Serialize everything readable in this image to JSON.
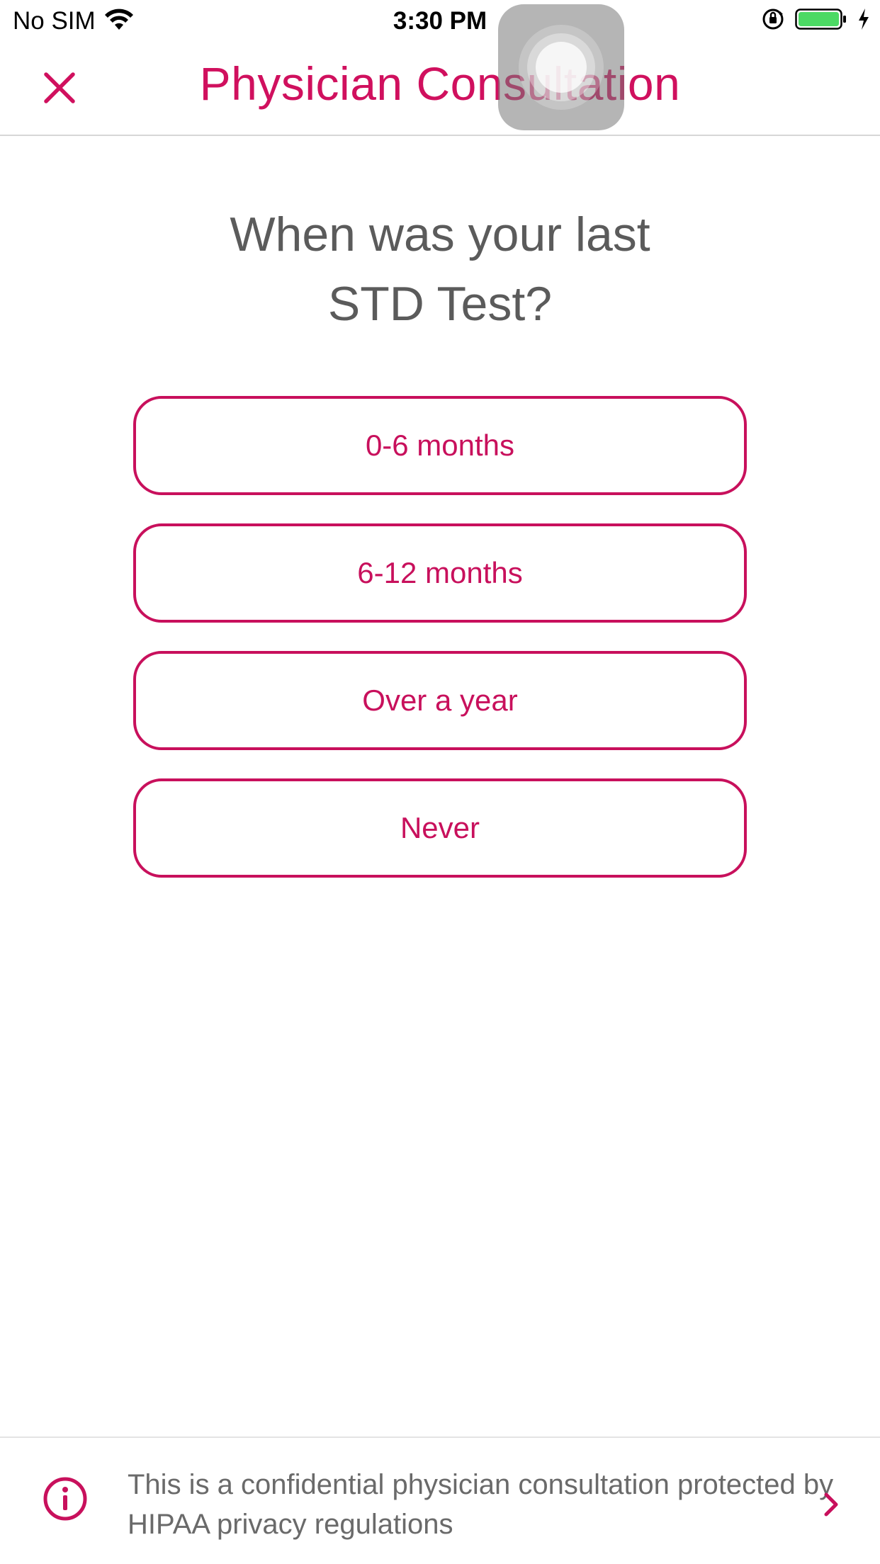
{
  "status_bar": {
    "carrier": "No SIM",
    "time": "3:30 PM",
    "battery_color": "#4cd964"
  },
  "nav": {
    "title": "Physician Consultation",
    "close_icon": "close-icon"
  },
  "question": {
    "line1": "When was your last",
    "line2": "STD Test?"
  },
  "options": [
    {
      "label": "0-6 months"
    },
    {
      "label": "6-12 months"
    },
    {
      "label": "Over a year"
    },
    {
      "label": "Never"
    }
  ],
  "footer": {
    "text": "This is a confidential physician consultation protected by HIPAA privacy regulations",
    "info_icon": "info-icon",
    "chevron_icon": "chevron-right-icon"
  },
  "colors": {
    "accent": "#c8105c",
    "text_gray": "#5b5b5b"
  }
}
